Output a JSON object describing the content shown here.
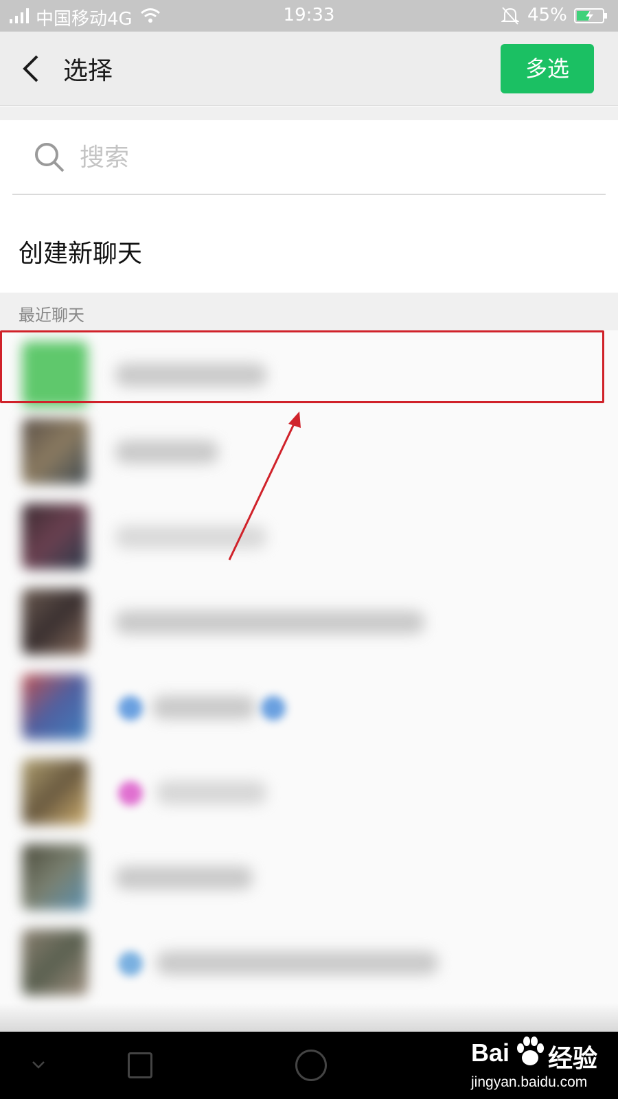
{
  "status_bar": {
    "carrier": "中国移动4G",
    "time": "19:33",
    "battery": "45%"
  },
  "header": {
    "title": "选择",
    "multi_select_label": "多选"
  },
  "search": {
    "placeholder": "搜索"
  },
  "new_chat_label": "创建新聊天",
  "recent_section_title": "最近聊天",
  "colors": {
    "accent_green": "#1bc063",
    "highlight_red": "#d0222a"
  },
  "watermark": {
    "brand_left": "Bai",
    "brand_right": "经验",
    "url": "jingyan.baidu.com"
  }
}
